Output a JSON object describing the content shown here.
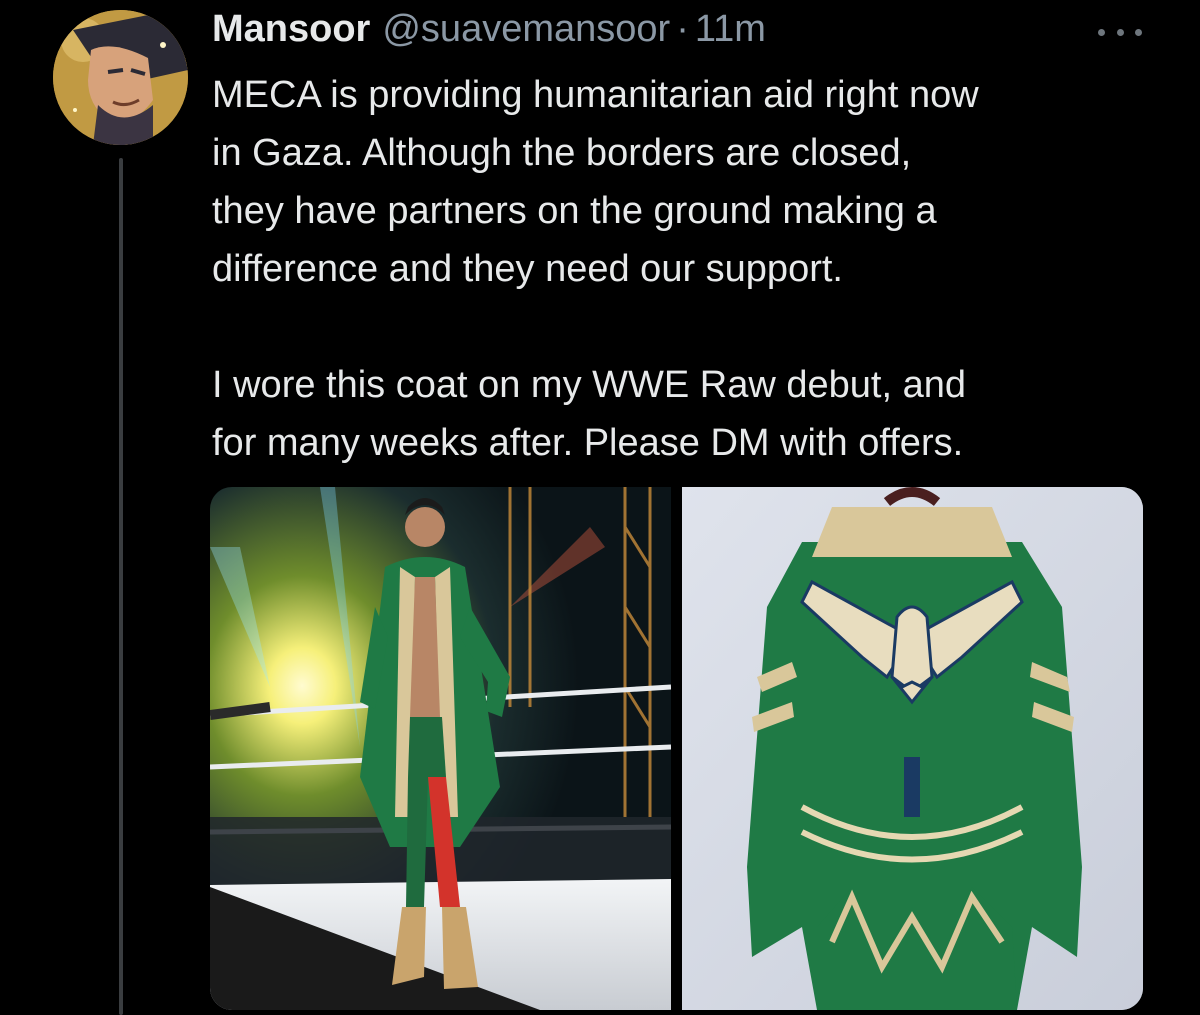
{
  "tweet": {
    "author": {
      "display_name": "Mansoor",
      "handle": "@suavemansoor",
      "separator": "·",
      "time": "11m"
    },
    "text": {
      "paragraph_1_lines": [
        "MECA is providing humanitarian aid right now",
        "in Gaza. Although the borders are closed,",
        "they have partners on the ground making a",
        "difference and they need our support."
      ],
      "paragraph_2_lines": [
        "I wore this coat on my WWE Raw debut, and",
        "for many weeks after. Please DM with offers."
      ]
    },
    "media": {
      "photos": [
        {
          "subject": "wrestler-in-green-coat-in-ring"
        },
        {
          "subject": "green-coat-back-on-hanger"
        }
      ]
    },
    "icons": {
      "more": "more-horizontal-icon"
    },
    "colors": {
      "background": "#000000",
      "text": "#e7e9ea",
      "secondary": "#8b98a5",
      "coat_green": "#1f7a45",
      "coat_gold": "#d9c79a"
    }
  }
}
